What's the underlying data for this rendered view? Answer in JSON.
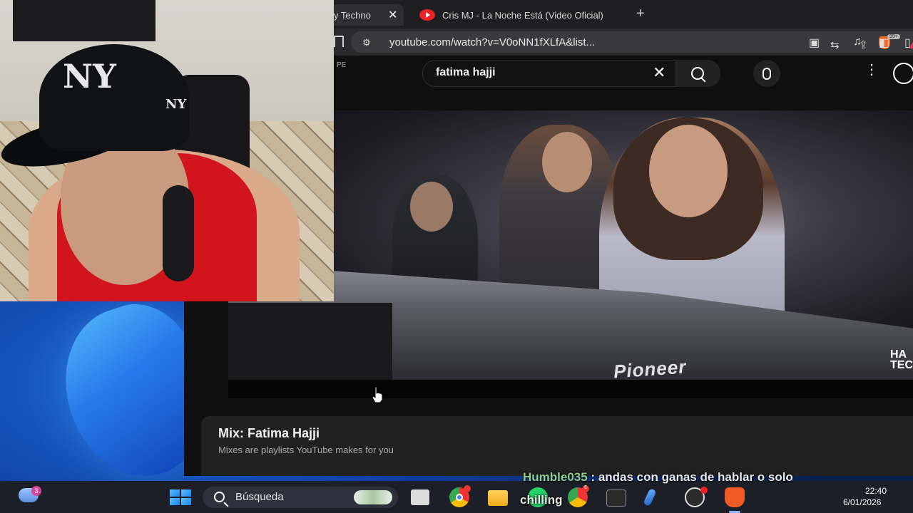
{
  "browser": {
    "tabs": [
      {
        "label": "y Techno"
      },
      {
        "label": "Cris MJ - La Noche Está (Video Oficial)"
      }
    ],
    "new_tab_label": "+",
    "url": "youtube.com/watch?v=V0oNN1fXLfA&list...",
    "shield_count": "99+",
    "rewards_count": "1"
  },
  "youtube": {
    "country_code": "PE",
    "search_value": "fatima hajji",
    "video": {
      "brand_text": "Pioneer",
      "watermark": "HA TEC"
    },
    "mix": {
      "title": "Mix: Fatima Hajji",
      "subtitle": "Mixes are playlists YouTube makes for you"
    }
  },
  "taskbar": {
    "weather_badge": "3",
    "search_placeholder": "Búsqueda",
    "chrome_badge": "6",
    "time": "22:40",
    "date": "6/01/2026"
  },
  "chat": {
    "username": "Humble035",
    "message_line1": ": andas con ganas de hablar o solo",
    "message_line2": "chilling"
  },
  "colors": {
    "youtube_bg": "#0f0f0f",
    "brand_red": "#ff0000",
    "chat_user": "#8fd08c"
  }
}
